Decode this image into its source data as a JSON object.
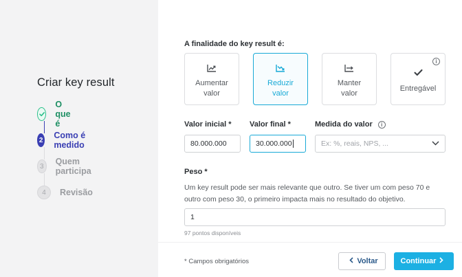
{
  "sidebar": {
    "title": "Criar key result",
    "steps": [
      {
        "number": "✓",
        "label": "O que é",
        "state": "done"
      },
      {
        "number": "2",
        "label": "Como é medido",
        "state": "current"
      },
      {
        "number": "3",
        "label": "Quem participa",
        "state": "pending"
      },
      {
        "number": "4",
        "label": "Revisão",
        "state": "pending"
      }
    ]
  },
  "purpose": {
    "label": "A finalidade do key result é:",
    "options": [
      {
        "label_line1": "Aumentar",
        "label_line2": "valor",
        "icon": "trend-up-icon",
        "selected": false
      },
      {
        "label_line1": "Reduzir",
        "label_line2": "valor",
        "icon": "trend-down-icon",
        "selected": true
      },
      {
        "label_line1": "Manter",
        "label_line2": "valor",
        "icon": "trend-flat-icon",
        "selected": false
      },
      {
        "label_line1": "Entregável",
        "label_line2": "",
        "icon": "check-icon",
        "selected": false
      }
    ],
    "info_symbol": "i"
  },
  "values": {
    "initial_label": "Valor inicial",
    "initial_value": "80.000.000",
    "final_label": "Valor final",
    "final_value": "30.000.000",
    "required_mark": "*",
    "measure_label": "Medida do valor",
    "measure_placeholder": "Ex: %, reais, NPS, ..."
  },
  "weight": {
    "label": "Peso",
    "required_mark": "*",
    "description": "Um key result pode ser mais relevante que outro. Se tiver um com peso 70 e outro com peso 30, o primeiro impacta mais no resultado do objetivo.",
    "value": "1",
    "hint": "97 pontos disponíveis"
  },
  "footer": {
    "required_note": "* Campos obrigatórios",
    "back_label": "Voltar",
    "next_label": "Continuar"
  },
  "colors": {
    "accent": "#17a9d6",
    "step_current": "#3a3fb3",
    "step_done": "#2bbf8a",
    "primary_button": "#1cb0e3"
  }
}
